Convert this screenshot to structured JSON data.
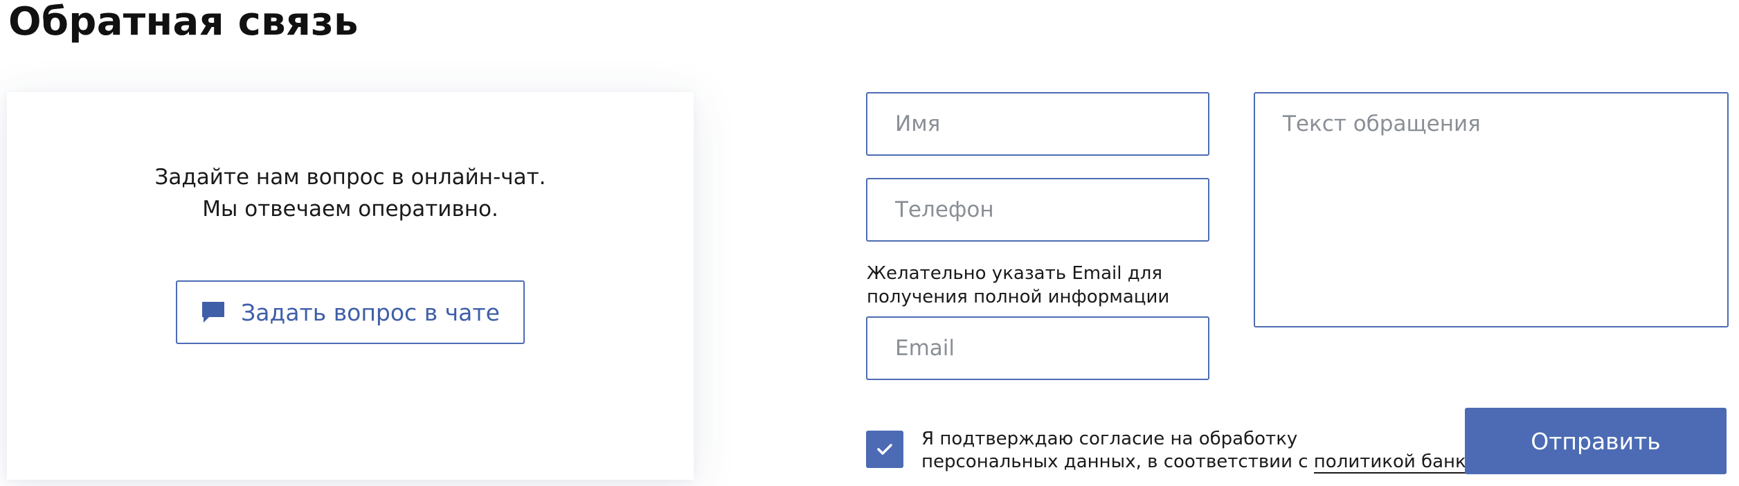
{
  "page": {
    "title": "Обратная связь"
  },
  "chat": {
    "line1": "Задайте нам вопрос в онлайн-чат.",
    "line2": "Мы отвечаем оперативно.",
    "button_label": "Задать вопрос в чате",
    "button_icon": "chat-bubble-icon"
  },
  "form": {
    "name_placeholder": "Имя",
    "phone_placeholder": "Телефон",
    "email_hint_line1": "Желательно указать Email для",
    "email_hint_line2": "получения полной информации",
    "email_placeholder": "Email",
    "message_placeholder": "Текст обращения",
    "consent_checked": true,
    "consent_line1": "Я подтверждаю согласие на обработку",
    "consent_line2_prefix": "персональных данных, в соответствии с ",
    "consent_link": "политикой банка",
    "submit_label": "Отправить"
  },
  "colors": {
    "accent": "#4c6bb4",
    "link_text": "#3f5fa8",
    "placeholder": "#8a8f96"
  }
}
